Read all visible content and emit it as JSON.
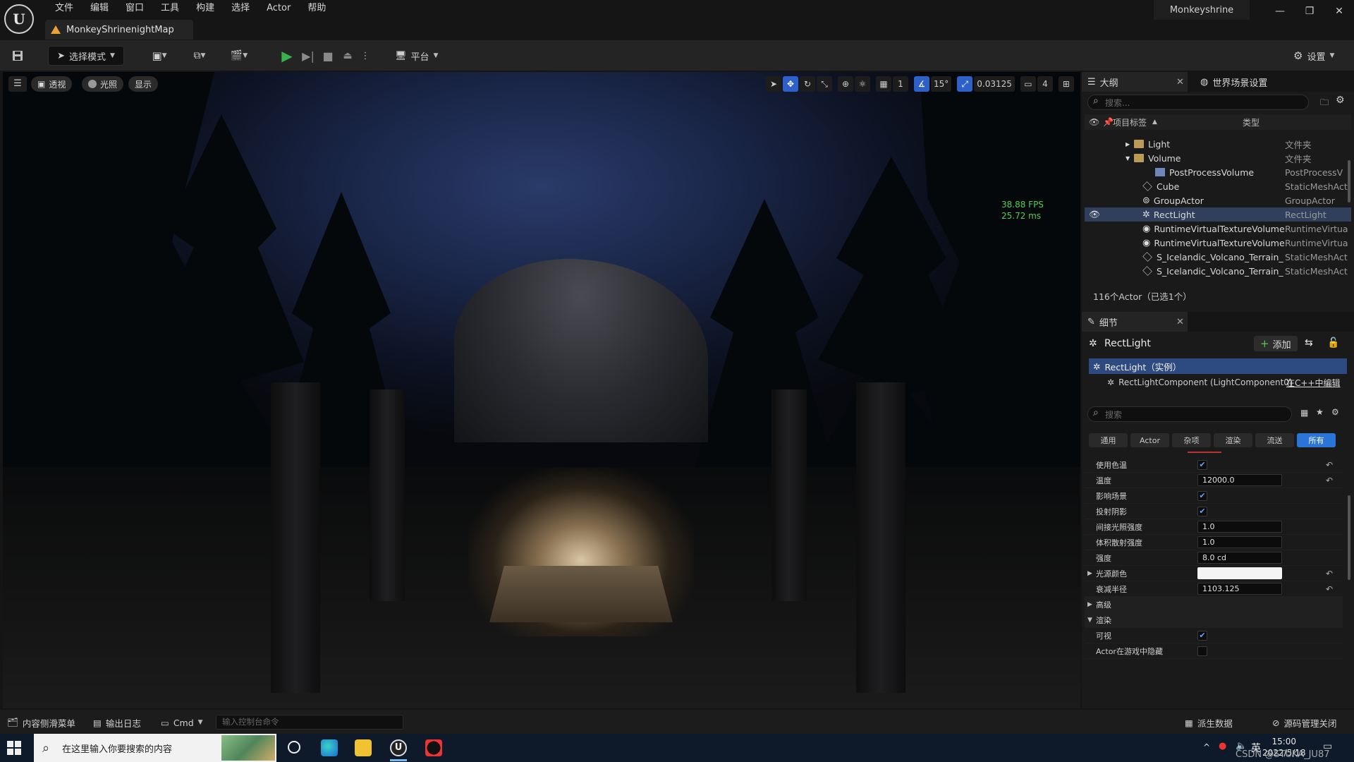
{
  "menu": [
    "文件",
    "编辑",
    "窗口",
    "工具",
    "构建",
    "选择",
    "Actor",
    "帮助"
  ],
  "document_tab": "MonkeyShrinenightMap",
  "project_name": "Monkeyshrine",
  "window": {
    "minimize": "—",
    "restore": "❐",
    "close": "✕"
  },
  "toolbar": {
    "select_mode": "选择模式",
    "platform": "平台",
    "settings": "设置"
  },
  "viewport": {
    "perspective": "透视",
    "lighting": "光照",
    "show": "显示",
    "grid_value": "1",
    "angle_value": "15°",
    "scale_value": "0.03125",
    "camera_speed": "4",
    "fps": "38.88 FPS",
    "frame_ms": "25.72 ms"
  },
  "outliner": {
    "tab_label": "大纲",
    "world_settings_tab": "世界场景设置",
    "search_placeholder": "搜索...",
    "col_label": "项目标签",
    "col_type": "类型",
    "rows": [
      {
        "label": "Light",
        "type": "文件夹"
      },
      {
        "label": "Volume",
        "type": "文件夹"
      },
      {
        "label": "PostProcessVolume",
        "type": "PostProcessV"
      },
      {
        "label": "Cube",
        "type": "StaticMeshAct"
      },
      {
        "label": "GroupActor",
        "type": "GroupActor"
      },
      {
        "label": "RectLight",
        "type": "RectLight"
      },
      {
        "label": "RuntimeVirtualTextureVolume",
        "type": "RuntimeVirtua"
      },
      {
        "label": "RuntimeVirtualTextureVolume",
        "type": "RuntimeVirtua"
      },
      {
        "label": "S_Icelandic_Volcano_Terrain_",
        "type": "StaticMeshAct"
      },
      {
        "label": "S_Icelandic_Volcano_Terrain_",
        "type": "StaticMeshAct"
      }
    ],
    "actor_count": "116个Actor（已选1个）"
  },
  "details": {
    "tab_label": "细节",
    "actor_name": "RectLight",
    "add_label": "添加",
    "instance_label": "RectLight（实例）",
    "component_label": "RectLightComponent (LightComponent0)",
    "cpp_link": "在C++中编辑",
    "search_placeholder": "搜索",
    "filters": [
      "通用",
      "Actor",
      "杂项",
      "渲染",
      "流送",
      "所有"
    ],
    "active_filter": 5,
    "properties": [
      {
        "label": "使用色温",
        "kind": "check",
        "checked": true,
        "value": "",
        "reset": true
      },
      {
        "label": "温度",
        "kind": "num",
        "value": "12000.0",
        "reset": true
      },
      {
        "label": "影响场景",
        "kind": "check",
        "checked": true,
        "value": ""
      },
      {
        "label": "投射阴影",
        "kind": "check",
        "checked": true,
        "value": ""
      },
      {
        "label": "间接光照强度",
        "kind": "num",
        "value": "1.0"
      },
      {
        "label": "体积散射强度",
        "kind": "num",
        "value": "1.0"
      },
      {
        "label": "强度",
        "kind": "num",
        "value": "8.0 cd"
      },
      {
        "label": "光源颜色",
        "kind": "color",
        "value": "",
        "reset": true
      },
      {
        "label": "衰减半径",
        "kind": "num",
        "value": "1103.125",
        "reset": true
      },
      {
        "label": "高级",
        "kind": "section"
      },
      {
        "label": "渲染",
        "kind": "section"
      },
      {
        "label": "可视",
        "kind": "check",
        "checked": true,
        "value": ""
      },
      {
        "label": "Actor在游戏中隐藏",
        "kind": "check",
        "checked": false,
        "value": ""
      }
    ]
  },
  "statusbar": {
    "content_drawer": "内容侧滑菜单",
    "output_log": "输出日志",
    "cmd": "Cmd",
    "console_placeholder": "输入控制台命令",
    "derived_data": "派生数据",
    "source_control": "源码管理关闭"
  },
  "taskbar": {
    "search_placeholder": "在这里输入你要搜索的内容",
    "time": "15:00",
    "date": "2022/5/18",
    "ime": "英",
    "watermark": "CSDN @STUKA_JU87"
  },
  "colors": {
    "accent": "#2a75d6",
    "selection": "#2f3f5c",
    "fps": "#4fcf54",
    "play": "#37b24d"
  }
}
